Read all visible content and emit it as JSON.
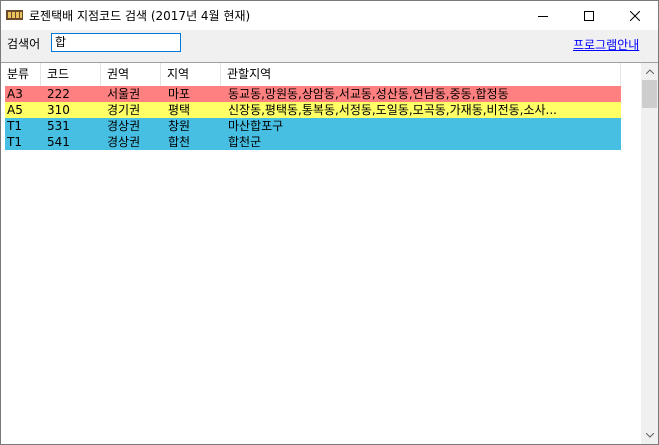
{
  "window": {
    "title": "로젠택배 지점코드 검색 (2017년 4월 현재)"
  },
  "search": {
    "label": "검색어",
    "value": "합"
  },
  "guide_link": "프로그램안내",
  "columns": [
    "분류",
    "코드",
    "권역",
    "지역",
    "관할지역"
  ],
  "rows": [
    {
      "cells": [
        "A3",
        "222",
        "서울권",
        "마포",
        "동교동,망원동,상암동,서교동,성산동,연남동,중동,합정동"
      ],
      "color": "#ff8080"
    },
    {
      "cells": [
        "A5",
        "310",
        "경기권",
        "평택",
        "신장동,평택동,통복동,서정동,도일동,모곡동,가재동,비전동,소사..."
      ],
      "color": "#ffff66"
    },
    {
      "cells": [
        "T1",
        "531",
        "경상권",
        "창원",
        "마산합포구"
      ],
      "color": "#47bfe3"
    },
    {
      "cells": [
        "T1",
        "541",
        "경상권",
        "합천",
        "합천군"
      ],
      "color": "#47bfe3"
    }
  ],
  "icons": {
    "app": "app-icon",
    "minimize": "minimize-icon",
    "maximize": "maximize-icon",
    "close": "close-icon"
  }
}
